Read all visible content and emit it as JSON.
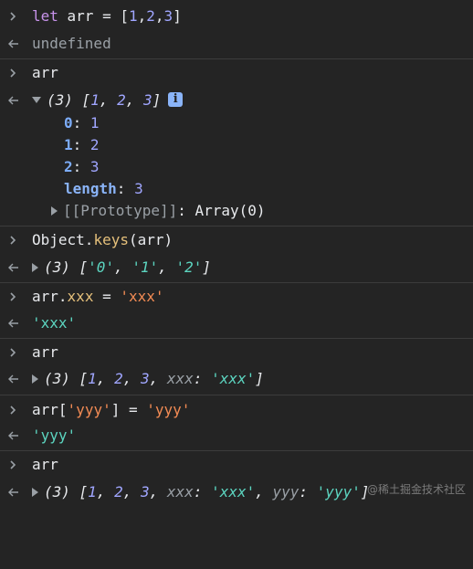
{
  "entries": {
    "e1": {
      "input": {
        "kw": "let",
        "name": " arr = ",
        "open": "[",
        "n1": "1",
        "c1": ",",
        "n2": "2",
        "c2": ",",
        "n3": "3",
        "close": "]"
      },
      "output": "undefined"
    },
    "e2": {
      "input": "arr",
      "output": {
        "count": "(3)",
        "preview_open": "[",
        "v1": "1",
        "v2": "2",
        "v3": "3",
        "preview_close": "]",
        "info_badge": "i",
        "props": [
          {
            "key": "0",
            "value": "1"
          },
          {
            "key": "1",
            "value": "2"
          },
          {
            "key": "2",
            "value": "3"
          }
        ],
        "length_key": "length",
        "length_value": "3",
        "prototype_key": "[[Prototype]]",
        "prototype_value": "Array(0)"
      }
    },
    "e3": {
      "input": {
        "obj": "Object",
        "dot": ".",
        "method": "keys",
        "args": "(arr)"
      },
      "output": {
        "count": "(3)",
        "s1": "'0'",
        "s2": "'1'",
        "s3": "'2'"
      }
    },
    "e4": {
      "input": {
        "obj": "arr",
        "dot": ".",
        "prop": "xxx",
        "eq": " = ",
        "val": "'xxx'"
      },
      "output": "'xxx'"
    },
    "e5": {
      "input": "arr",
      "output": {
        "count": "(3)",
        "v1": "1",
        "v2": "2",
        "v3": "3",
        "key": "xxx",
        "val": "'xxx'"
      }
    },
    "e6": {
      "input": {
        "obj": "arr",
        "open": "[",
        "key": "'yyy'",
        "close": "]",
        "eq": " = ",
        "val": "'yyy'"
      },
      "output": "'yyy'"
    },
    "e7": {
      "input": "arr",
      "output": {
        "count": "(3)",
        "v1": "1",
        "v2": "2",
        "v3": "3",
        "key1": "xxx",
        "val1": "'xxx'",
        "key2": "yyy",
        "val2": "'yyy'"
      }
    }
  },
  "watermark": "@稀土掘金技术社区",
  "colors": {
    "background": "#242424",
    "separator": "#3c3c3c",
    "keyword": "#c792ea",
    "number": "#a0a6ff",
    "string": "#5cd5c0",
    "string_input": "#f28b54",
    "property": "#e5c07b",
    "muted": "#9aa0a6",
    "key": "#7cacf8",
    "badge": "#8ab4f8"
  },
  "icons": {
    "input_prompt": "chevron-right-icon",
    "output_return": "return-arrow-icon",
    "expand": "triangle-right-icon",
    "collapse": "triangle-down-icon",
    "info": "info-icon"
  }
}
